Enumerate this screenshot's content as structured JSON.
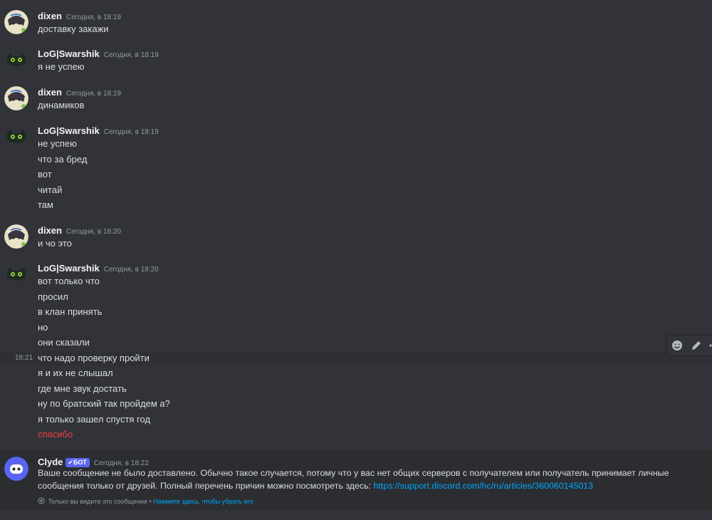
{
  "messages": [
    {
      "user": "dixen",
      "time": "Сегодня, в 18:19",
      "avatar": "dixen-avatar",
      "lines": [
        "доставку закажи"
      ]
    },
    {
      "user": "LoG|Swarshik",
      "time": "Сегодня, в 18:19",
      "avatar": "swarshik-avatar",
      "lines": [
        "я не успею"
      ]
    },
    {
      "user": "dixen",
      "time": "Сегодня, в 18:19",
      "avatar": "dixen-avatar",
      "lines": [
        "динамиков"
      ]
    },
    {
      "user": "LoG|Swarshik",
      "time": "Сегодня, в 18:19",
      "avatar": "swarshik-avatar",
      "lines": [
        "не успею",
        "что за бред",
        "вот",
        "читай",
        "там"
      ]
    },
    {
      "user": "dixen",
      "time": "Сегодня, в 18:20",
      "avatar": "dixen-avatar",
      "lines": [
        "и чо это"
      ]
    },
    {
      "user": "LoG|Swarshik",
      "time": "Сегодня, в 18:20",
      "avatar": "swarshik-avatar",
      "lines": [
        "вот только что",
        "просил",
        "в клан принять",
        "но",
        "они сказали",
        "что надо проверку пройти",
        "я и их не слышал",
        "где мне звук достать",
        "ну по братский так пройдем а?",
        "я только зашел спустя год",
        "спасибо"
      ]
    }
  ],
  "hover": {
    "time": "18:21",
    "tools": [
      "add-reaction-icon",
      "edit-pencil-icon",
      "more-icon"
    ]
  },
  "failed_line": "спасибо",
  "clyde": {
    "user": "Clyde",
    "badge_check": "✔",
    "badge": "БОТ",
    "time": "Сегодня, в 18:22",
    "text1": "Ваше сообщение не было доставлено. Обычно такое случается, потому что у вас нет общих серверов с получателем или получатель принимает личные",
    "text2": "сообщения только от друзей. Полный перечень причин можно посмотреть здесь: ",
    "link": "https://support.discord.com/hc/ru/articles/360060145013",
    "note": "Только вы видите это сообщение • ",
    "note_link": "Нажмите здесь, чтобы убрать его"
  },
  "colors": {
    "background": "#313338",
    "bot_area": "#2b2d31",
    "accent": "#5865f2",
    "link": "#00a8fc",
    "error": "#f23f43"
  }
}
